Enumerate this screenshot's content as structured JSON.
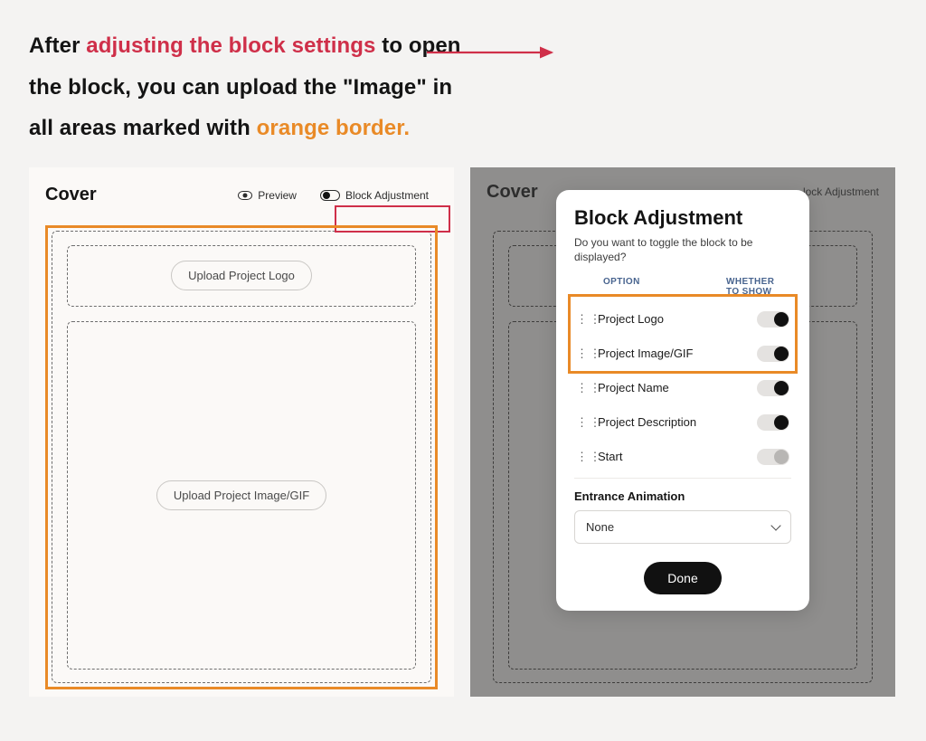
{
  "headline": {
    "p1a": "After ",
    "p1b": "adjusting the block settings",
    "p1c": " to open",
    "p2": "the block, you can upload the \"Image\" in",
    "p3a": "all areas marked with ",
    "p3b": "orange border."
  },
  "left": {
    "title": "Cover",
    "preview_label": "Preview",
    "block_adjust_label": "Block Adjustment",
    "upload_logo": "Upload Project Logo",
    "upload_image": "Upload Project Image/GIF"
  },
  "right": {
    "title": "Cover",
    "block_adjust_label": "lock Adjustment"
  },
  "popup": {
    "title": "Block Adjustment",
    "subtitle": "Do you want to toggle the block to be displayed?",
    "legend_option": "OPTION",
    "legend_show": "WHETHER TO SHOW",
    "rows": [
      {
        "label": "Project Logo",
        "on": true
      },
      {
        "label": "Project Image/GIF",
        "on": true
      },
      {
        "label": "Project Name",
        "on": true
      },
      {
        "label": "Project Description",
        "on": true
      },
      {
        "label": "Start",
        "on": false
      }
    ],
    "entrance_label": "Entrance Animation",
    "entrance_value": "None",
    "done": "Done"
  }
}
